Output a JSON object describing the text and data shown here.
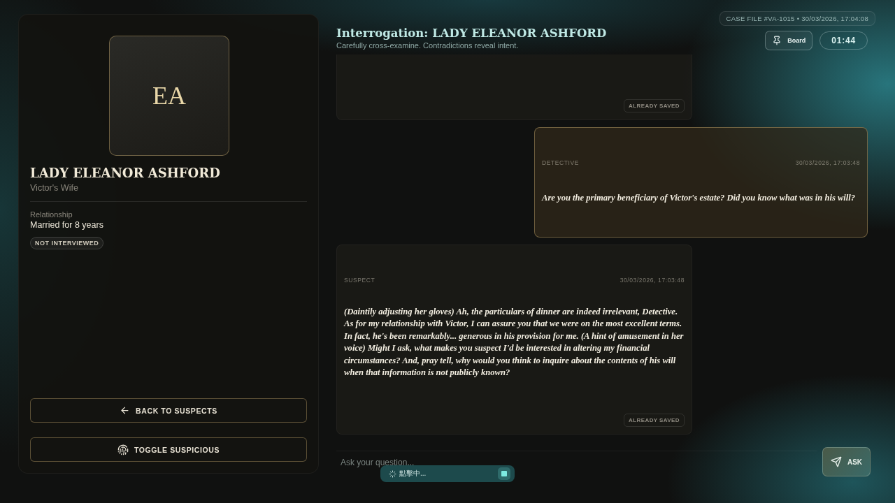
{
  "suspect": {
    "initials": "EA",
    "name": "LADY ELEANOR ASHFORD",
    "role": "Victor's Wife",
    "relationship_label": "Relationship",
    "relationship": "Married for 8 years",
    "status": "NOT INTERVIEWED"
  },
  "actions": [
    {
      "kind": "back",
      "label": "BACK TO SUSPECTS"
    },
    {
      "kind": "suspicious",
      "label": "TOGGLE SUSPICIOUS"
    }
  ],
  "header": {
    "title": "Interrogation: LADY ELEANOR ASHFORD",
    "subtitle": "Carefully cross-examine. Contradictions reveal intent.",
    "case_file": "CASE FILE #VA-1015 • 30/03/2026, 17:04:08",
    "board": "Board",
    "timer": "01:44"
  },
  "messages": [
    {
      "kind": "suspect",
      "badge": "ALREADY SAVED"
    },
    {
      "kind": "detective",
      "sender": "DETECTIVE",
      "time": "30/03/2026, 17:03:48",
      "text": "Are you the primary beneficiary of Victor's estate? Did you know what was in his will?"
    },
    {
      "kind": "suspect",
      "sender": "SUSPECT",
      "time": "30/03/2026, 17:03:48",
      "text": "(Daintily adjusting her gloves) Ah, the particulars of dinner are indeed irrelevant, Detective. As for my relationship with Victor, I can assure you that we were on the most excellent terms. In fact, he's been remarkably... generous in his provision for me. (A hint of amusement in her voice) Might I ask, what makes you suspect I'd be interested in altering my financial circumstances? And, pray tell, why would you think to inquire about the contents of his will when that information is not publicly known?",
      "badge": "ALREADY SAVED"
    }
  ],
  "composer": {
    "placeholder": "Ask your question...",
    "button": "ASK"
  },
  "recording": {
    "label": "點擊中..."
  }
}
